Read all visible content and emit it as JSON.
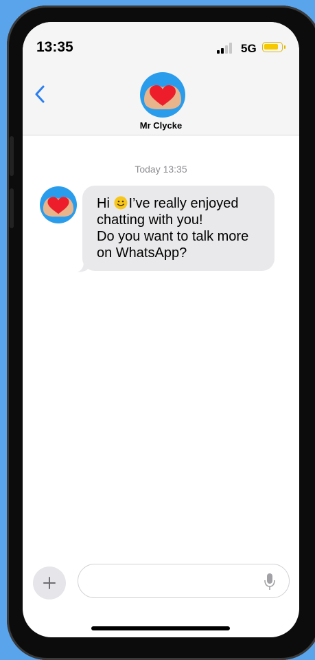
{
  "status_bar": {
    "time": "13:35",
    "network": "5G",
    "signal_bars_filled": 2,
    "signal_bars_total": 4,
    "battery_color": "#f5c800"
  },
  "header": {
    "back_icon": "chevron-left-icon",
    "contact_name": "Mr Clycke",
    "avatar_icon": "heart-hands-icon",
    "accent_color": "#2a7ff0"
  },
  "conversation": {
    "timestamp": "Today 13:35",
    "messages": [
      {
        "sender": "Mr Clycke",
        "lines": [
          "Hi",
          "I’ve really enjoyed",
          "chatting with you!",
          "Do you want to talk more",
          "on WhatsApp?"
        ],
        "emoji": "slightly-smiling-face"
      }
    ]
  },
  "composer": {
    "add_icon": "plus-icon",
    "placeholder": "",
    "mic_icon": "microphone-icon"
  }
}
